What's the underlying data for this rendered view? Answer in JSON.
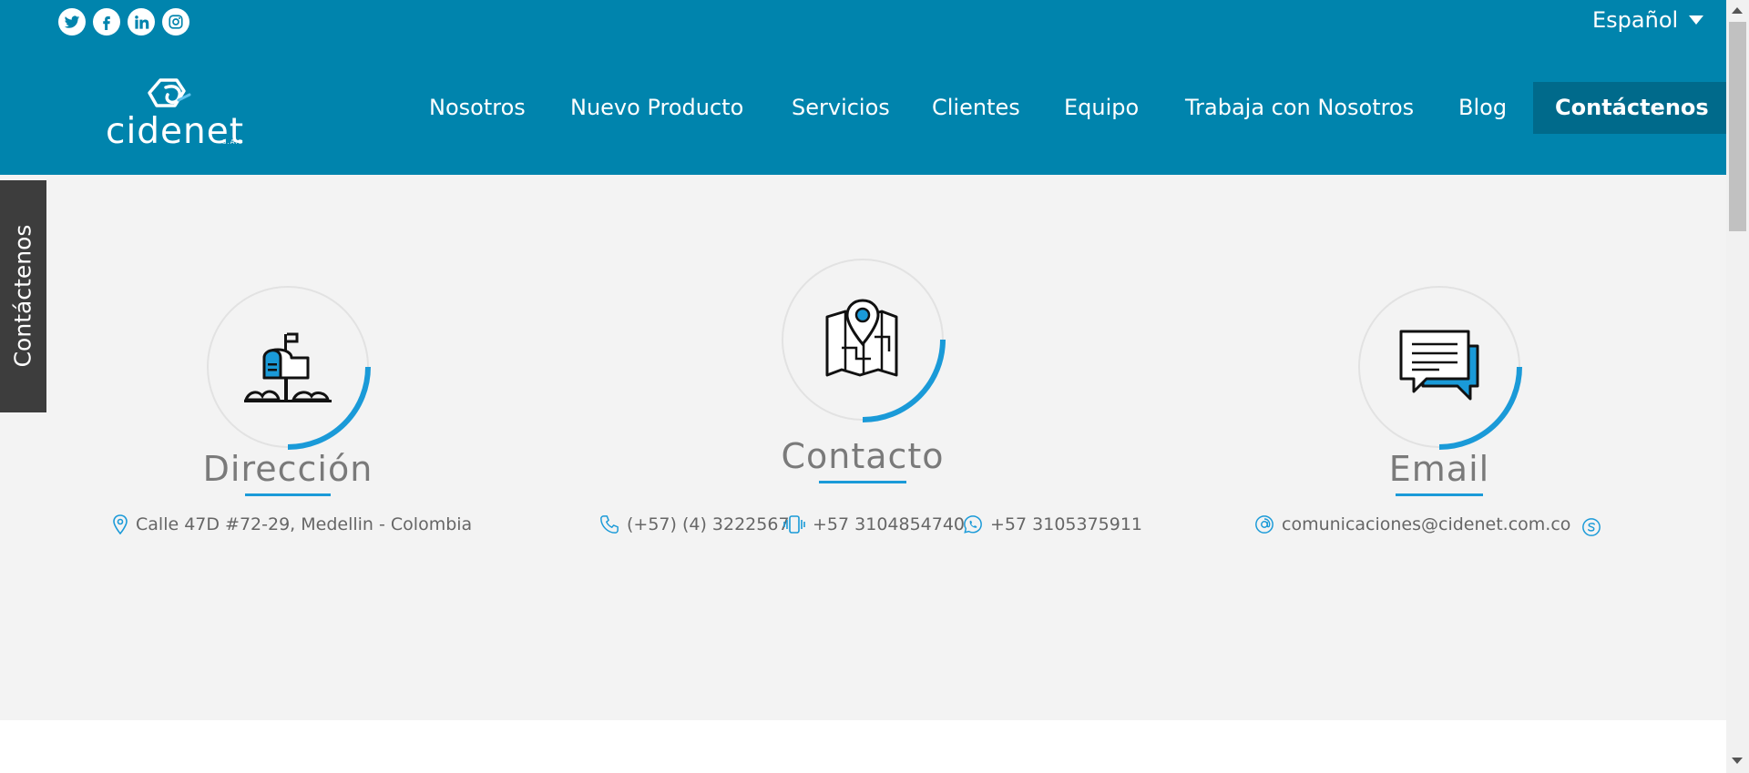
{
  "header": {
    "social": [
      "twitter-icon",
      "facebook-icon",
      "linkedin-icon",
      "instagram-icon"
    ],
    "language": "Español",
    "logo_text": "cidenet",
    "logo_suffix": "S.A.S",
    "nav": [
      "Nosotros",
      "Nuevo Producto",
      "Servicios",
      "Clientes",
      "Equipo",
      "Trabaja con Nosotros",
      "Blog"
    ],
    "cta": "Contáctenos"
  },
  "side_tab": "Contáctenos",
  "sections": {
    "direccion": {
      "title": "Dirección",
      "address": "Calle 47D #72-29, Medellin - Colombia"
    },
    "contacto": {
      "title": "Contacto",
      "phone": "(+57) (4) 3222567",
      "mobile": "+57 3104854740",
      "whatsapp": "+57 3105375911"
    },
    "email": {
      "title": "Email",
      "address": "comunicaciones@cidenet.com.co"
    }
  },
  "colors": {
    "header_bg": "#0084ad",
    "cta_bg": "#006a8b",
    "accent": "#1a9ad8",
    "side_tab_bg": "#3d3d3d",
    "page_bg": "#f3f3f3"
  }
}
